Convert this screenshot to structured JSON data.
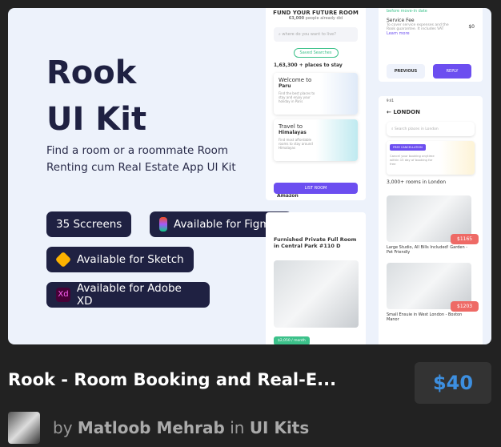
{
  "thumbnail": {
    "title_line1": "Rook",
    "title_line2": "UI Kit",
    "subtitle": "Find a room or a roommate Room Renting cum Real Estate App UI Kit",
    "badges": [
      {
        "label": "35 Sccreens"
      },
      {
        "label": "Available for Figma",
        "icon": "figma-icon"
      },
      {
        "label": "Available for Sketch",
        "icon": "sketch-icon"
      },
      {
        "label": "Available for Adobe XD",
        "icon": "xd-icon",
        "icon_text": "Xd"
      }
    ],
    "screen1": {
      "heading": "FUND YOUR FUTURE ROOM",
      "count": "63,000",
      "count_suffix": "people already did",
      "search_placeholder": "where do you want to live?",
      "saved": "Saved Searches",
      "places": "1,63,300 + places to stay",
      "card1_title1": "Welcome to",
      "card1_title2": "Paru",
      "card1_text": "Find the best places to stay and enjoy your holiday in Paris",
      "card2_title1": "Travel to",
      "card2_title2": "Himalayas",
      "card2_text": "Find most affordable rooms to stay around Himalayas",
      "list_room": "LIST ROOM",
      "next": "Amazon"
    },
    "screen2": {
      "note": "before move-in date",
      "fee_title": "Service Fee",
      "fee_text": "To cover service expenses and the Rook guarantee. It includes VAT",
      "fee_value": "$0",
      "learn": "Learn more",
      "previous": "PREVIOUS",
      "reply": "REPLY"
    },
    "screen3": {
      "time": "9:41",
      "city": "LONDON",
      "search_placeholder": "Search places in London",
      "free": "FREE CANCELLATION",
      "free_text": "Cancel your booking anytime within 15 day of booking for free",
      "rooms": "3,000+ rooms in London",
      "listing1_price": "$1165",
      "listing1_title": "Large Studio, All Bills Included! Garden - Pet Friendly",
      "listing2_price": "$1203",
      "listing2_title": "Small Ensuie in West London - Boston Manor"
    },
    "screen4": {
      "title": "Furnished Private Full Room in Central Park #110 D",
      "price": "$2,050 / month"
    }
  },
  "product": {
    "title": "Rook - Room Booking and Real-E...",
    "price": "$40",
    "by": "by",
    "author": "Matloob Mehrab",
    "in": "in",
    "category": "UI Kits"
  },
  "colors": {
    "accent": "#6c4ef0",
    "navy": "#1f2142",
    "price": "#3d8fe0"
  }
}
